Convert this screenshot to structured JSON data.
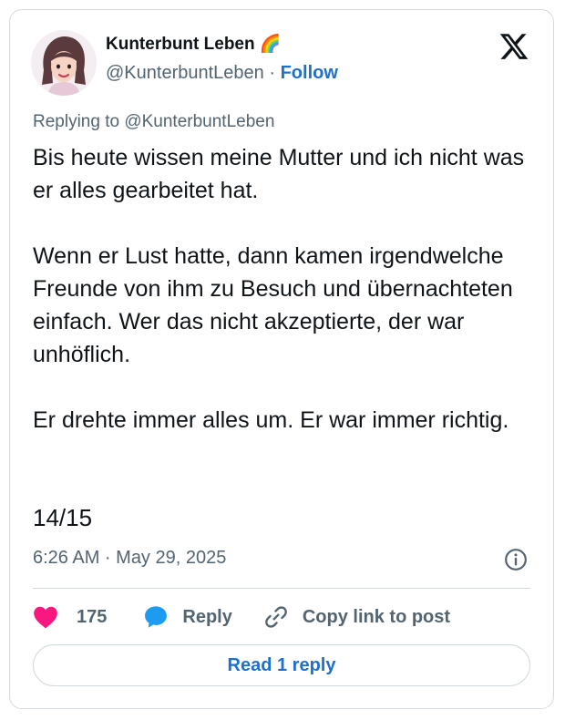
{
  "author": {
    "display_name": "Kunterbunt Leben 🌈",
    "handle": "@KunterbuntLeben",
    "separator": "·",
    "follow_label": "Follow"
  },
  "platform_icon": "x-logo-icon",
  "replying_to": "Replying to @KunterbuntLeben",
  "post": {
    "paragraphs": [
      "Bis heute wissen meine Mutter und ich nicht was er alles gearbeitet hat.",
      "Wenn er Lust hatte, dann kamen irgendwelche Freunde von ihm zu Besuch und übernachteten einfach. Wer das nicht akzeptierte, der war unhöflich.",
      "Er drehte immer alles um. Er war immer richtig."
    ],
    "thread_count": "14/15"
  },
  "meta": {
    "timestamp": "6:26 AM · May 29, 2025"
  },
  "actions": {
    "likes": "175",
    "reply_label": "Reply",
    "copy_link_label": "Copy link to post"
  },
  "read_replies_label": "Read 1 reply",
  "colors": {
    "accent": "#1d6fd0",
    "heart": "#f91880",
    "reply_bubble": "#1d9bf0",
    "text_secondary": "#536471",
    "text_primary": "#0f1419"
  }
}
